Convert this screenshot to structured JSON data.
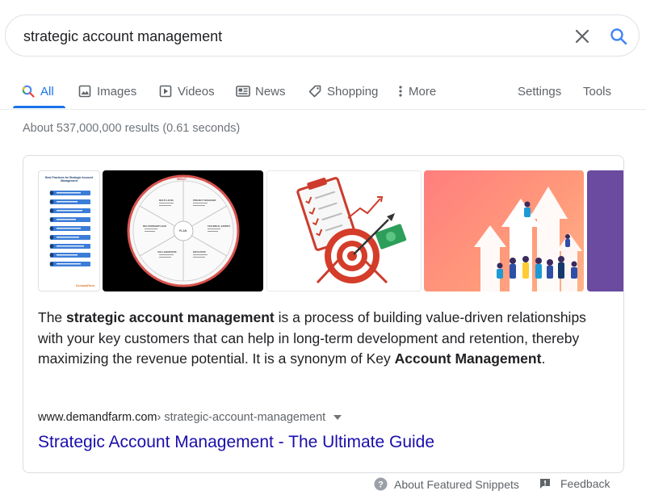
{
  "search": {
    "query": "strategic account management",
    "clear_icon": "close-icon",
    "search_icon": "search-icon"
  },
  "tabs": [
    {
      "label": "All",
      "icon": "search-icon",
      "active": true
    },
    {
      "label": "Images",
      "icon": "image-icon"
    },
    {
      "label": "Videos",
      "icon": "play-icon"
    },
    {
      "label": "News",
      "icon": "news-icon"
    },
    {
      "label": "Shopping",
      "icon": "tag-icon"
    },
    {
      "label": "More",
      "icon": "more-vert-icon"
    }
  ],
  "tools": {
    "settings": "Settings",
    "tools": "Tools"
  },
  "results_stats": "About 537,000,000 results (0.61 seconds)",
  "featured_snippet": {
    "text_parts": [
      {
        "t": "The ",
        "b": false
      },
      {
        "t": "strategic account management",
        "b": true
      },
      {
        "t": " is a process of building value-driven relationships with your key customers that can help in long-term development and retention, thereby maximizing the revenue potential. It is a synonym of Key ",
        "b": false
      },
      {
        "t": "Account Management",
        "b": true
      },
      {
        "t": ".",
        "b": false
      }
    ],
    "site": "www.demandfarm.com",
    "path": " › strategic-account-management",
    "title": "Strategic Account Management - The Ultimate Guide",
    "images": {
      "img1": {
        "heading": "Best Practices for Strategic Account Management",
        "footer": "DemandFarm"
      },
      "img2": {
        "top": "IMPACT",
        "center": "PLAN",
        "sections": [
          "MULTI-LEVEL",
          "PROJECT MANAGER",
          "TECHNICAL EXPERT",
          "EDUCATOR",
          "COLLABORATOR",
          "RELATIONSHIP LEAD"
        ]
      }
    }
  },
  "footer": {
    "about": "About Featured Snippets",
    "feedback": "Feedback"
  },
  "colors": {
    "accent": "#1a73e8",
    "link": "#1a0dab",
    "muted": "#70757a",
    "google_blue": "#4285f4"
  }
}
